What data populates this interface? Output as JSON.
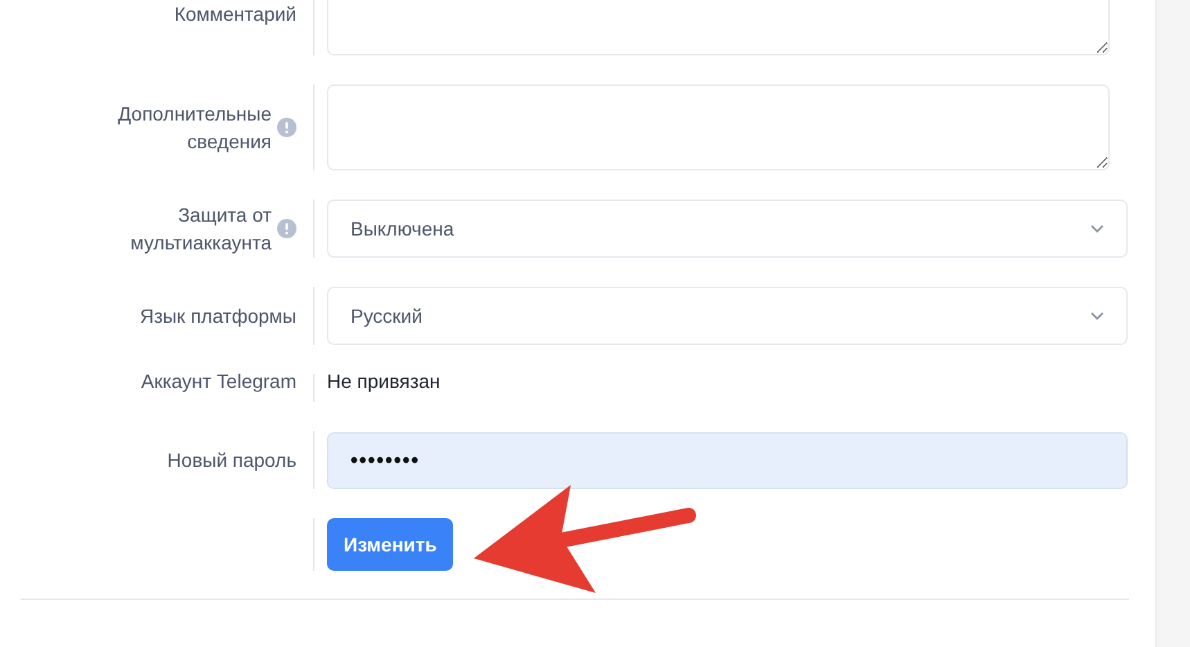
{
  "form": {
    "rows": [
      {
        "kind": "textarea",
        "label": "Комментарий",
        "hint": false,
        "cut": true
      },
      {
        "kind": "textarea",
        "label": "Дополнительные сведения",
        "hint": true,
        "cut": false
      },
      {
        "kind": "select",
        "label": "Защита от мультиаккаунта",
        "hint": true,
        "value": "Выключена"
      },
      {
        "kind": "select",
        "label": "Язык платформы",
        "hint": false,
        "value": "Русский"
      },
      {
        "kind": "text",
        "label": "Аккаунт Telegram",
        "hint": false,
        "value": "Не привязан"
      },
      {
        "kind": "password",
        "label": "Новый пароль",
        "hint": false,
        "value": "••••••••"
      },
      {
        "kind": "button",
        "label": "Изменить"
      }
    ]
  }
}
